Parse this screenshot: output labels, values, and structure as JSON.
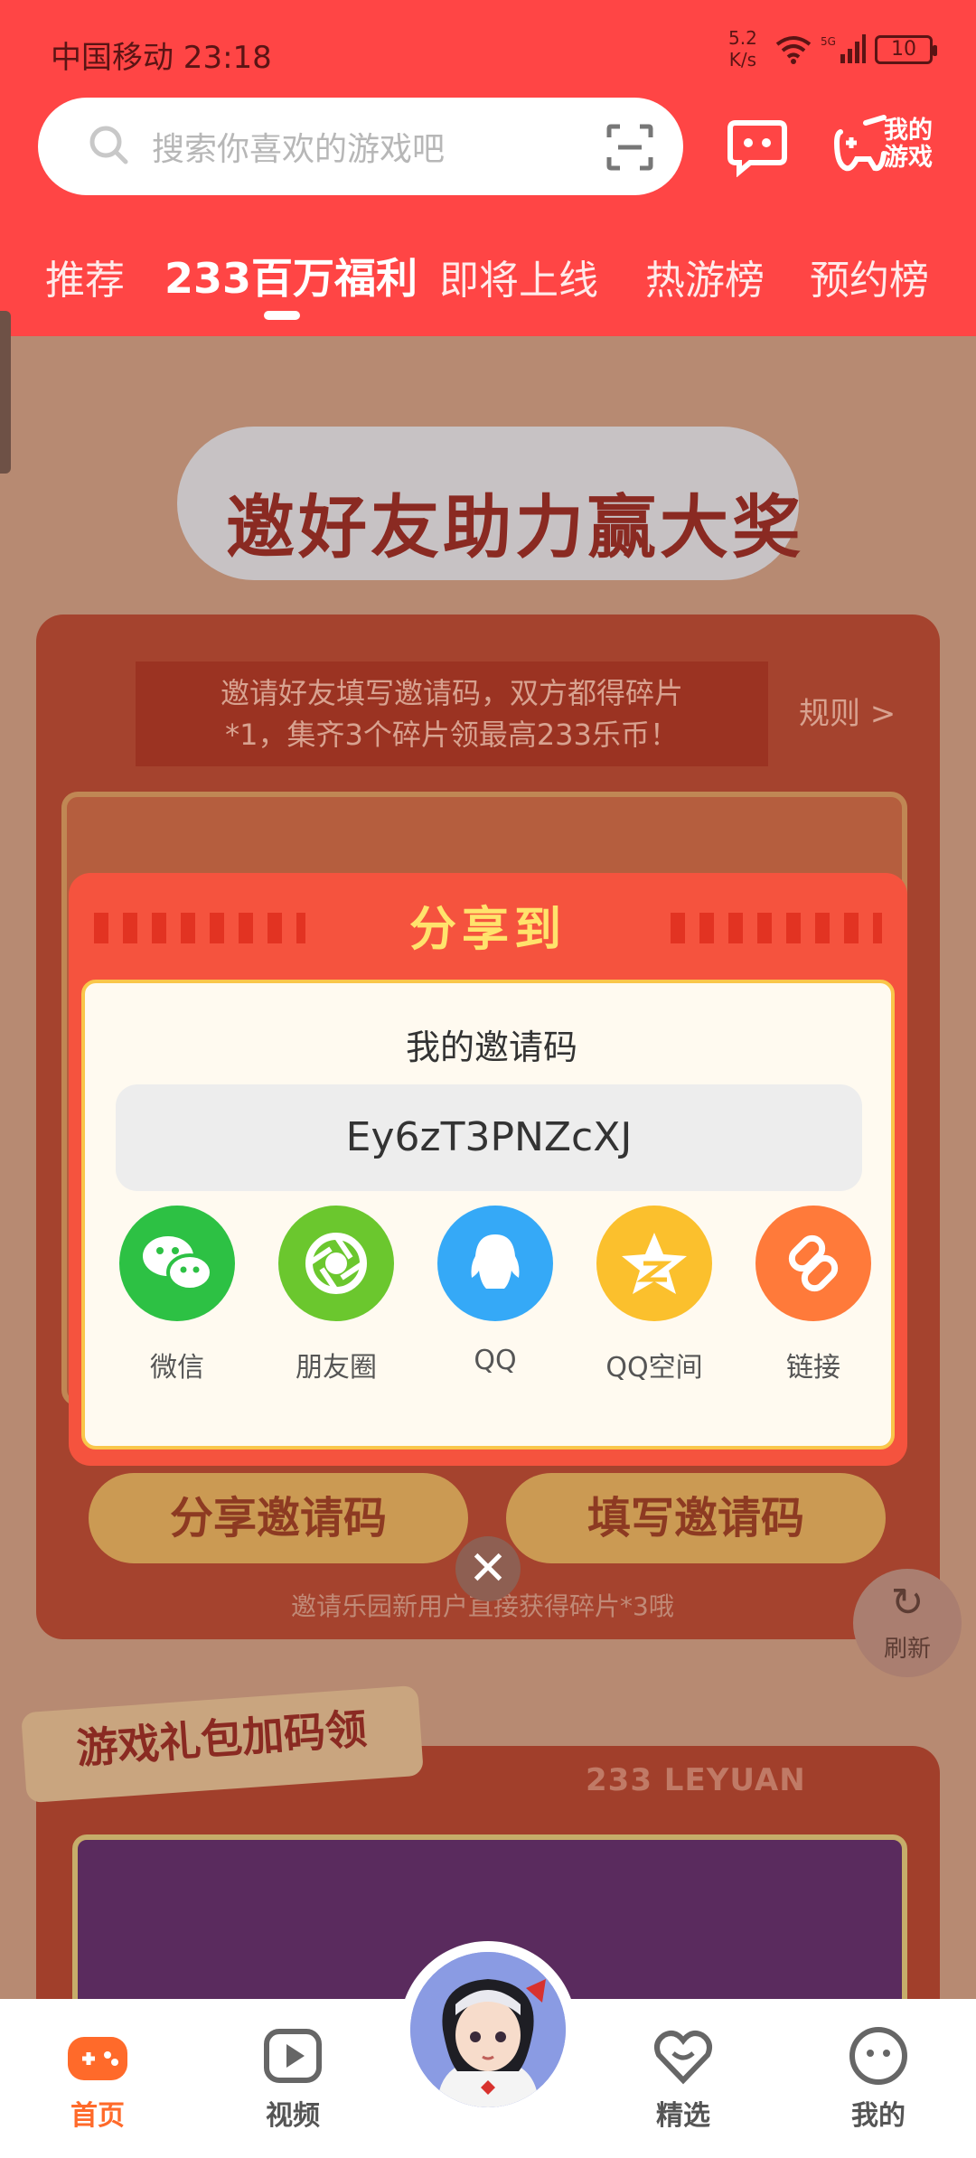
{
  "status_bar": {
    "carrier_time": "中国移动 23:18",
    "speed": "5.2\nK/s",
    "battery": "10"
  },
  "search": {
    "placeholder": "搜索你喜欢的游戏吧"
  },
  "header": {
    "my_games": "我的\n游戏"
  },
  "tabs": [
    {
      "label": "推荐",
      "active": false
    },
    {
      "label": "233百万福利",
      "active": true
    },
    {
      "label": "即将上线",
      "active": false
    },
    {
      "label": "热游榜",
      "active": false
    },
    {
      "label": "预约榜",
      "active": false
    }
  ],
  "background": {
    "event_title": "邀好友助力赢大奖",
    "event_note": "邀请好友填写邀请码，双方都得碎片\n*1，集齐3个碎片领最高233乐币！",
    "rule_link": "规则 >",
    "share_code_button": "分享邀请码",
    "fill_code_button": "填写邀请码",
    "invite_hint": "邀请乐园新用户直接获得碎片*3哦",
    "gift_banner": "游戏礼包加码领",
    "leyuan_label": "233 LEYUAN"
  },
  "modal": {
    "title": "分享到",
    "code_label": "我的邀请码",
    "code": "Ey6zT3PNZcXJ",
    "share_targets": [
      {
        "label": "微信",
        "icon": "wechat-icon",
        "color": "#2dc144"
      },
      {
        "label": "朋友圈",
        "icon": "moments-icon",
        "color": "#6bc72e"
      },
      {
        "label": "QQ",
        "icon": "qq-icon",
        "color": "#35a9f7"
      },
      {
        "label": "QQ空间",
        "icon": "qzone-icon",
        "color": "#fbc02d"
      },
      {
        "label": "链接",
        "icon": "link-icon",
        "color": "#ff7a3a"
      }
    ]
  },
  "refresh_label": "刷新",
  "bottom_nav": [
    {
      "label": "首页",
      "active": true
    },
    {
      "label": "视频",
      "active": false
    },
    {
      "label": "精选",
      "active": false
    },
    {
      "label": "我的",
      "active": false
    }
  ],
  "colors": {
    "header_red": "#ff4545",
    "modal_red": "#f5533e",
    "accent_yellow": "#ffe36c",
    "nav_active": "#ff6a2a"
  }
}
